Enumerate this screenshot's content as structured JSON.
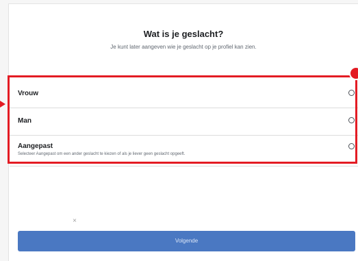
{
  "header": {
    "title": "Wat is je geslacht?",
    "subtitle": "Je kunt later aangeven wie je geslacht op je profiel kan zien."
  },
  "options": [
    {
      "label": "Vrouw",
      "selected": false
    },
    {
      "label": "Man",
      "selected": false
    },
    {
      "label": "Aangepast",
      "description": "Selecteer Aangepast om een ander geslacht te kiezen of als je liever geen geslacht opgeeft.",
      "selected": false
    }
  ],
  "footer": {
    "close_symbol": "×",
    "next_label": "Volgende"
  },
  "colors": {
    "accent_button": "#4a78c2",
    "highlight": "#e31b23"
  },
  "icons": {
    "radio": "radio-button-icon",
    "close": "close-icon"
  }
}
